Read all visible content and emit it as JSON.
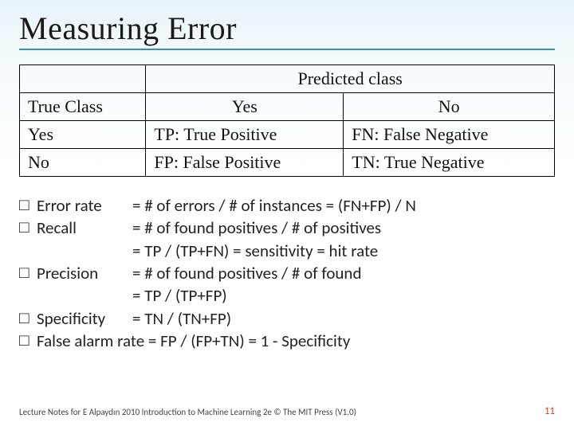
{
  "title": "Measuring Error",
  "table": {
    "predicted_header": "Predicted class",
    "true_header": "True Class",
    "col_yes": "Yes",
    "col_no": "No",
    "row_yes": "Yes",
    "row_no": "No",
    "cell_tp": "TP: True Positive",
    "cell_fn": "FN: False Negative",
    "cell_fp": "FP: False Positive",
    "cell_tn": "TN: True Negative"
  },
  "bullet_symbol": "□",
  "lines": {
    "l1_term": "Error rate",
    "l1_def": "= # of errors / # of instances = (FN+FP) / N",
    "l2_term": "Recall",
    "l2_def": "= # of found positives / # of positives",
    "l3_def": "= TP / (TP+FN) = sensitivity = hit rate",
    "l4_term": "Precision",
    "l4_def": "= # of found positives / # of found",
    "l5_def": "= TP / (TP+FP)",
    "l6_term": "Specificity",
    "l6_def": "= TN / (TN+FP)",
    "l7_full": "False alarm rate = FP / (FP+TN) = 1 - Specificity"
  },
  "footer": "Lecture Notes for E Alpaydın 2010 Introduction to Machine Learning 2e © The MIT Press (V1.0)",
  "page_number": "11"
}
